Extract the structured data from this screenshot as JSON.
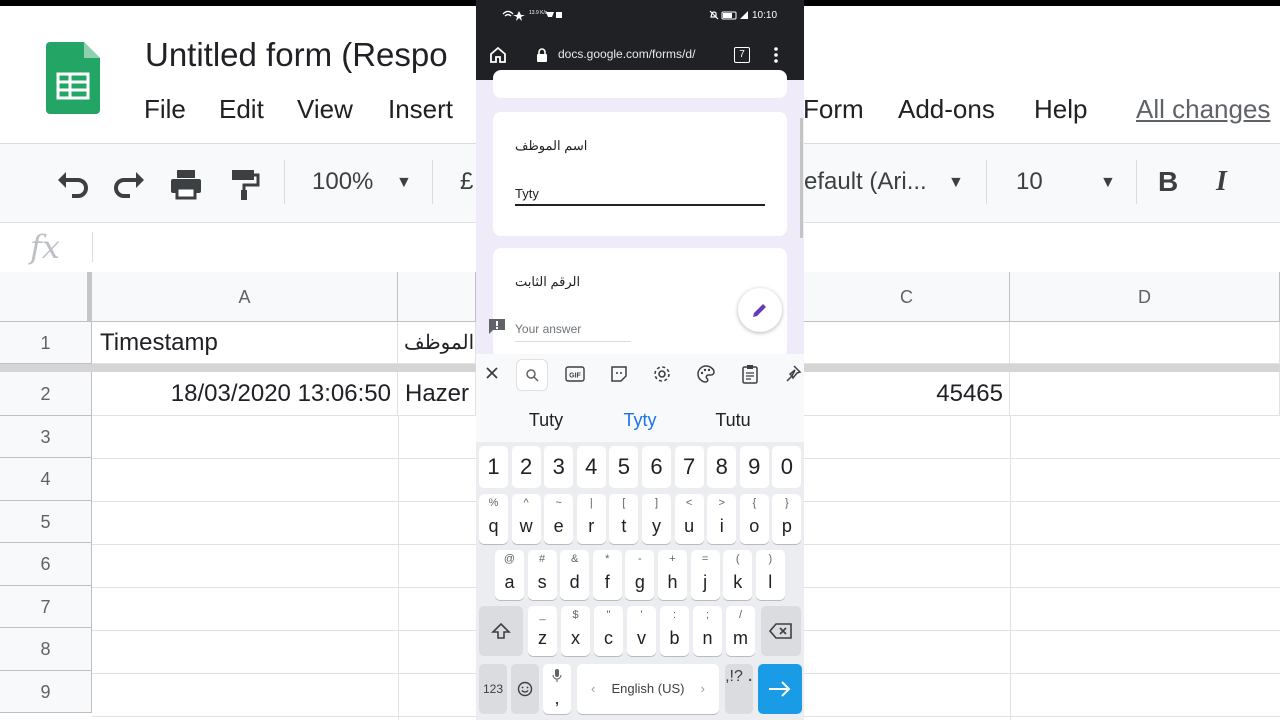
{
  "sheets": {
    "doc_title": "Untitled form (Respo",
    "menu": [
      "File",
      "Edit",
      "View",
      "Insert",
      "Form",
      "Add-ons",
      "Help"
    ],
    "all_changes": "All changes",
    "toolbar": {
      "zoom": "100%",
      "currency": "£",
      "font": "efault (Ari...",
      "font_size": "10",
      "bold": "B",
      "italic": "I"
    },
    "fx": "fx",
    "columns": [
      "A",
      "C",
      "D"
    ],
    "rows": [
      "1",
      "2",
      "3",
      "4",
      "5",
      "6",
      "7",
      "8",
      "9"
    ],
    "cells": {
      "a1": "Timestamp",
      "b1": "الموظف",
      "a2": "18/03/2020 13:06:50",
      "b2": "Hazer",
      "c2": "45465"
    }
  },
  "phone": {
    "status": {
      "speed": "13.9 K/s",
      "time": "10:10"
    },
    "url": "docs.google.com/forms/d/",
    "tab_count": "7",
    "form": {
      "q1_title": "اسم الموظف",
      "q1_answer": "Tyty",
      "q2_title": "الرقم الثابت",
      "q2_placeholder": "Your answer"
    },
    "keyboard": {
      "suggestions": [
        "Tuty",
        "Tyty",
        "Tutu"
      ],
      "numbers": [
        "1",
        "2",
        "3",
        "4",
        "5",
        "6",
        "7",
        "8",
        "9",
        "0"
      ],
      "row1": [
        [
          "q",
          "%"
        ],
        [
          "w",
          "^"
        ],
        [
          "e",
          "~"
        ],
        [
          "r",
          "|"
        ],
        [
          "t",
          "["
        ],
        [
          "y",
          "]"
        ],
        [
          "u",
          "<"
        ],
        [
          "i",
          ">"
        ],
        [
          "o",
          "{"
        ],
        [
          "p",
          "}"
        ]
      ],
      "row2": [
        [
          "a",
          "@"
        ],
        [
          "s",
          "#"
        ],
        [
          "d",
          "&"
        ],
        [
          "f",
          "*"
        ],
        [
          "g",
          "-"
        ],
        [
          "h",
          "+"
        ],
        [
          "j",
          "="
        ],
        [
          "k",
          "("
        ],
        [
          "l",
          ")"
        ]
      ],
      "row3": [
        [
          "z",
          "_"
        ],
        [
          "x",
          "$"
        ],
        [
          "c",
          "\""
        ],
        [
          "v",
          "'"
        ],
        [
          "b",
          ":"
        ],
        [
          "n",
          ";"
        ],
        [
          "m",
          "/"
        ]
      ],
      "sym_label": "123",
      "space_label": "English (US)",
      "comma": ",",
      "period": ".",
      "punct_alt": ",!?"
    },
    "colors": {
      "accent": "#1a9be6",
      "suggest_active": "#1a73e8"
    }
  }
}
